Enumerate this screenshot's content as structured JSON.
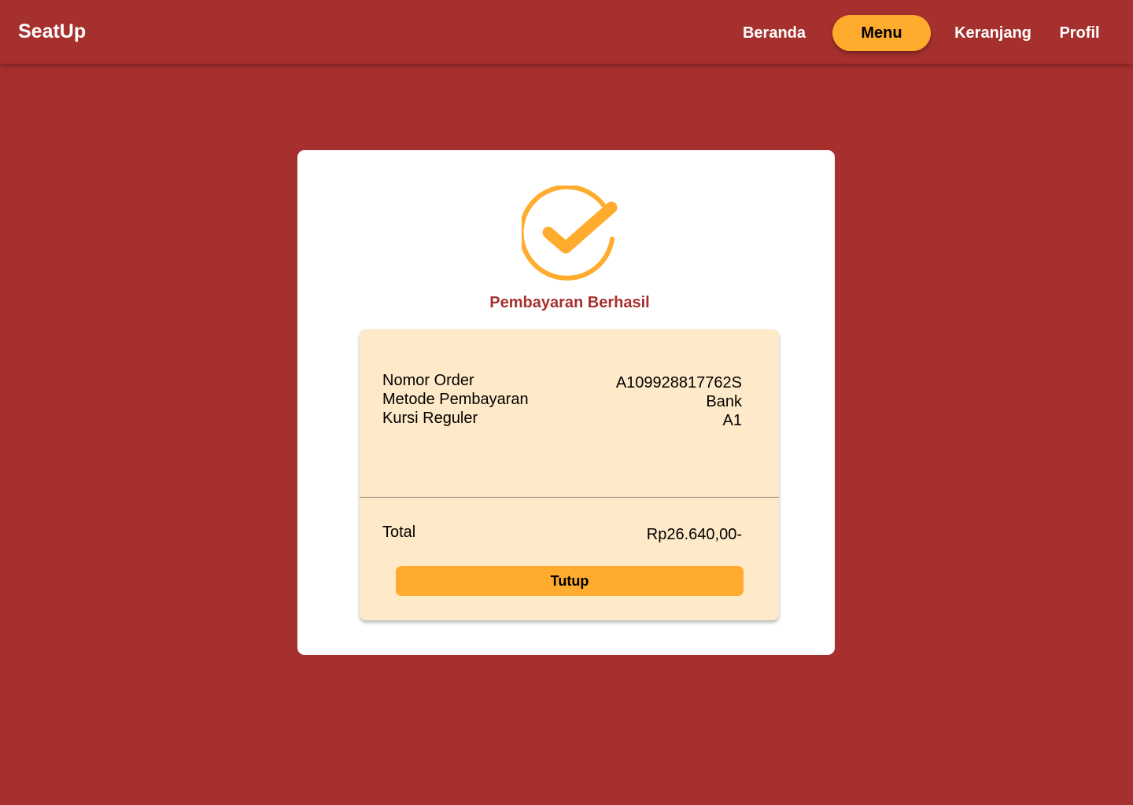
{
  "nav": {
    "brand": "SeatUp",
    "items": [
      {
        "label": "Beranda"
      },
      {
        "label": "Menu",
        "active": true
      },
      {
        "label": "Keranjang"
      },
      {
        "label": "Profil"
      }
    ]
  },
  "modal": {
    "icon": "check-circle-icon",
    "title": "Pembayaran Berhasil",
    "details": [
      {
        "label": "Nomor Order",
        "value": "A109928817762S"
      },
      {
        "label": "Metode Pembayaran",
        "value": "Bank"
      },
      {
        "label": "Kursi Reguler",
        "value": "A1"
      }
    ],
    "total_label": "Total",
    "total_value": "Rp26.640,00-",
    "close_label": "Tutup"
  },
  "colors": {
    "background": "#A6302D",
    "accent": "#FFAB2E",
    "card": "#FEE9C8",
    "title": "#A6302D"
  }
}
